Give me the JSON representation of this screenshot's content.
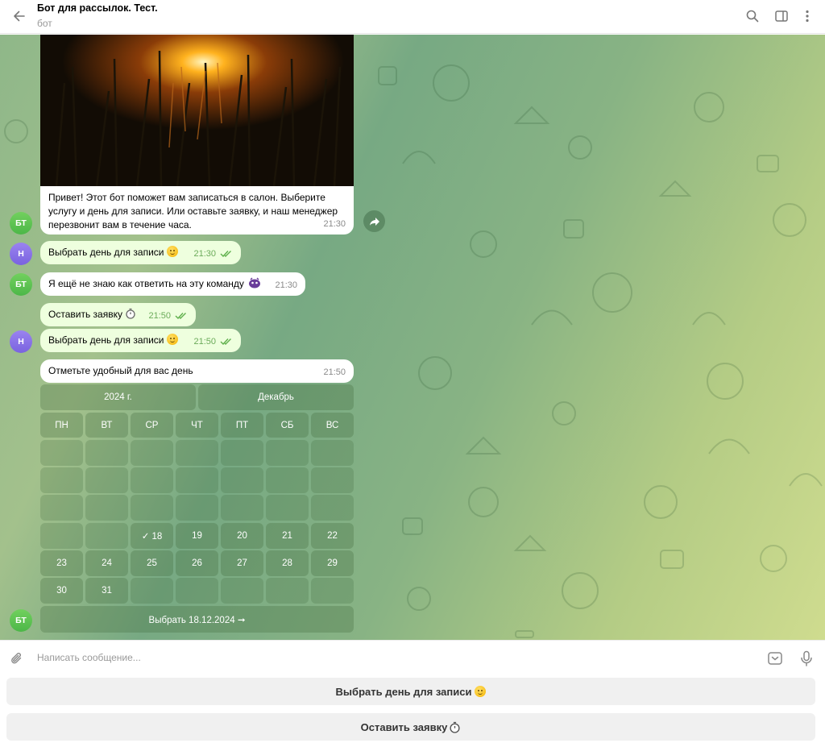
{
  "header": {
    "title": "Бот для рассылок. Тест.",
    "subtitle": "бот"
  },
  "messages": {
    "greeting": {
      "text": "Привет! Этот бот поможет вам записаться в салон. Выберите услугу и день для записи. Или оставьте заявку, и наш менеджер перезвонит вам в течение часа.",
      "time": "21:30"
    },
    "user_pick_day_1": {
      "text": "Выбрать день для записи",
      "time": "21:30"
    },
    "bot_unknown": {
      "text": "Я ещё не знаю как ответить на эту команду",
      "time": "21:30"
    },
    "leave_request": {
      "text": "Оставить заявку",
      "time": "21:50"
    },
    "user_pick_day_2": {
      "text": "Выбрать день для записи",
      "time": "21:50"
    },
    "bot_calendar": {
      "text": "Отметьте удобный для вас день",
      "time": "21:50"
    }
  },
  "avatars": {
    "bot": "БТ",
    "user": "Н"
  },
  "calendar": {
    "year": "2024 г.",
    "month": "Декабрь",
    "weekdays": [
      "ПН",
      "ВТ",
      "СР",
      "ЧТ",
      "ПТ",
      "СБ",
      "ВС"
    ],
    "weeks": [
      [
        "",
        "",
        "",
        "",
        "",
        "",
        ""
      ],
      [
        "",
        "",
        "",
        "",
        "",
        "",
        ""
      ],
      [
        "",
        "",
        "",
        "",
        "",
        "",
        ""
      ],
      [
        "",
        "",
        "✓ 18",
        "19",
        "20",
        "21",
        "22"
      ],
      [
        "23",
        "24",
        "25",
        "26",
        "27",
        "28",
        "29"
      ],
      [
        "30",
        "31",
        "",
        "",
        "",
        "",
        ""
      ]
    ],
    "confirm": "Выбрать 18.12.2024 ➞"
  },
  "composer": {
    "placeholder": "Написать сообщение..."
  },
  "reply_keyboard": {
    "pick_day": "Выбрать день для записи",
    "leave_request": "Оставить заявку"
  },
  "icons": {
    "back": "arrow-left-icon",
    "search": "search-icon",
    "sidebar": "sidebar-toggle-icon",
    "menu": "more-vertical-icon",
    "attach": "paperclip-icon",
    "keyboard": "bot-keyboard-icon",
    "mic": "microphone-icon",
    "forward": "forward-icon"
  },
  "colors": {
    "bubble_in": "#ffffff",
    "bubble_out": "#eeffde",
    "bot_avatar": "#5bc24f",
    "user_avatar": "#8a72e8"
  }
}
